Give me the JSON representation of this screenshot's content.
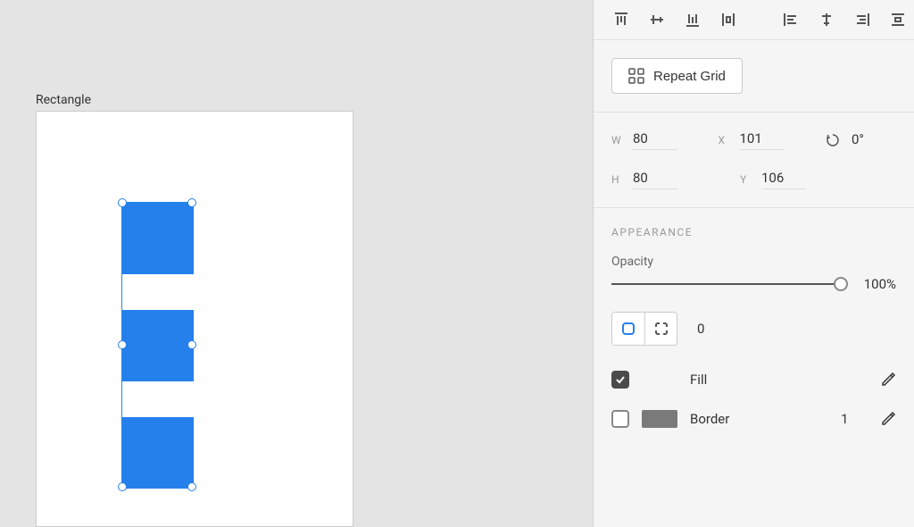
{
  "canvas": {
    "artboard_label": "Rectangle"
  },
  "toolbar": {
    "repeat_grid_label": "Repeat Grid"
  },
  "transform": {
    "w_label": "W",
    "w_value": "80",
    "h_label": "H",
    "h_value": "80",
    "x_label": "X",
    "x_value": "101",
    "y_label": "Y",
    "y_value": "106",
    "rotation_value": "0°"
  },
  "appearance": {
    "section_title": "APPEARANCE",
    "opacity_label": "Opacity",
    "opacity_value": "100%",
    "corner_radius_value": "0",
    "fill": {
      "label": "Fill",
      "color": "#2680eb",
      "enabled": true
    },
    "border": {
      "label": "Border",
      "color": "#7a7a7a",
      "width": "1",
      "enabled": false
    }
  }
}
